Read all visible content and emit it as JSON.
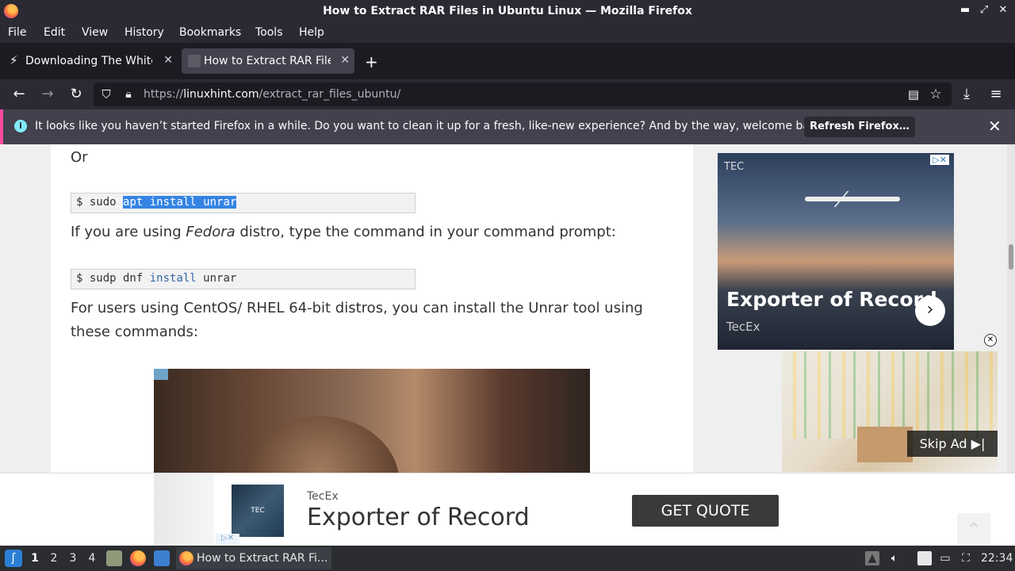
{
  "window": {
    "title": "How to Extract RAR Files in Ubuntu Linux — Mozilla Firefox"
  },
  "menu": [
    "File",
    "Edit",
    "View",
    "History",
    "Bookmarks",
    "Tools",
    "Help"
  ],
  "tabs": [
    {
      "label": "Downloading The White",
      "active": false
    },
    {
      "label": "How to Extract RAR Files",
      "active": true
    }
  ],
  "url": {
    "prefix": "https://",
    "domain": "linuxhint.com",
    "path": "/extract_rar_files_ubuntu/"
  },
  "notification": {
    "message": "It looks like you haven’t started Firefox in a while. Do you want to clean it up for a fresh, like-new experience? And by the way, welcome back!",
    "button": "Refresh Firefox…"
  },
  "article": {
    "or_text": "Or",
    "code1": {
      "prompt": "$ sudo ",
      "selected": "apt install unrar"
    },
    "fedora_pre": "If you are using ",
    "fedora_em": "Fedora",
    "fedora_post": " distro, type the command in your command prompt:",
    "code2": {
      "prompt": "$ sudp dnf ",
      "kw": "install",
      "rest": " unrar"
    },
    "centos_text": "For users using CentOS/ RHEL 64-bit distros, you can install the Unrar tool using these commands:"
  },
  "ads": {
    "side": {
      "brand": "TEC",
      "headline": "Exporter of Record",
      "sub": "TecEx"
    },
    "video": {
      "skip": "Skip Ad"
    },
    "bottom": {
      "brand": "TecEx",
      "title": "Exporter of Record",
      "cta": "GET QUOTE"
    }
  },
  "taskbar": {
    "workspaces": [
      "1",
      "2",
      "3",
      "4"
    ],
    "active_task": "How to Extract RAR Fi...",
    "clock": "22:34"
  },
  "colors": {
    "notification_accent": "#ff4aa2",
    "selection": "#3584e4",
    "taskbar": "#2b2d31"
  }
}
